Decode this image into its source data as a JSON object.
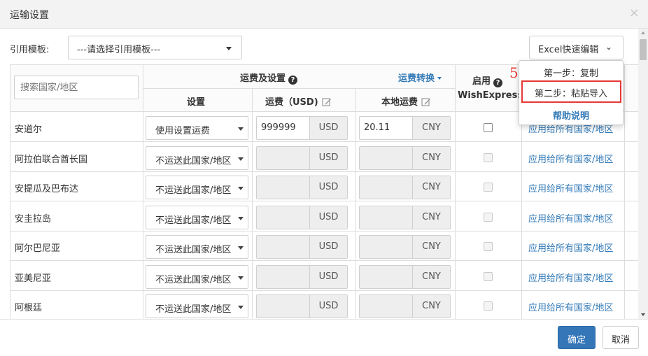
{
  "dialog": {
    "title": "运输设置",
    "close_glyph": "×"
  },
  "template": {
    "label": "引用模板:",
    "selected": "---请选择引用模板---"
  },
  "excel_button": {
    "label": "Excel快速编辑",
    "chevron": "⌄"
  },
  "dropdown_menu": {
    "items": [
      {
        "label": "第一步：复制"
      },
      {
        "label": "第二步：粘贴导入"
      },
      {
        "label": "帮助说明"
      }
    ],
    "highlight_color": "#e53935"
  },
  "annotation": {
    "step_number": "5"
  },
  "table": {
    "search_placeholder": "搜索国家/地区",
    "group_header": "运费及设置",
    "convert_link": "运费转换",
    "enable_label": "启用",
    "wish_express_label": "WishExpress",
    "col_setting": "设置",
    "col_freight": "运费（USD)",
    "col_local": "本地运费",
    "help_glyph": "?",
    "rows": [
      {
        "country": "安道尔",
        "setting": "使用设置运费",
        "freight": "999999",
        "freight_unit": "USD",
        "local": "20.11",
        "local_unit": "CNY",
        "apply": "应用给所有国家/地区"
      },
      {
        "country": "阿拉伯联合酋长国",
        "setting": "不运送此国家/地区",
        "freight": "",
        "freight_unit": "USD",
        "local": "",
        "local_unit": "CNY",
        "apply": "应用给所有国家/地区"
      },
      {
        "country": "安提瓜及巴布达",
        "setting": "不运送此国家/地区",
        "freight": "",
        "freight_unit": "USD",
        "local": "",
        "local_unit": "CNY",
        "apply": "应用给所有国家/地区"
      },
      {
        "country": "安圭拉岛",
        "setting": "不运送此国家/地区",
        "freight": "",
        "freight_unit": "USD",
        "local": "",
        "local_unit": "CNY",
        "apply": "应用给所有国家/地区"
      },
      {
        "country": "阿尔巴尼亚",
        "setting": "不运送此国家/地区",
        "freight": "",
        "freight_unit": "USD",
        "local": "",
        "local_unit": "CNY",
        "apply": "应用给所有国家/地区"
      },
      {
        "country": "亚美尼亚",
        "setting": "不运送此国家/地区",
        "freight": "",
        "freight_unit": "USD",
        "local": "",
        "local_unit": "CNY",
        "apply": "应用给所有国家/地区"
      },
      {
        "country": "阿根廷",
        "setting": "不运送此国家/地区",
        "freight": "",
        "freight_unit": "USD",
        "local": "",
        "local_unit": "CNY",
        "apply": "应用给所有国家/地区"
      }
    ]
  },
  "footer": {
    "ok": "确定",
    "cancel": "取消"
  },
  "colors": {
    "primary": "#3576b8",
    "link": "#337ab7",
    "annotation_red": "#e53935"
  }
}
